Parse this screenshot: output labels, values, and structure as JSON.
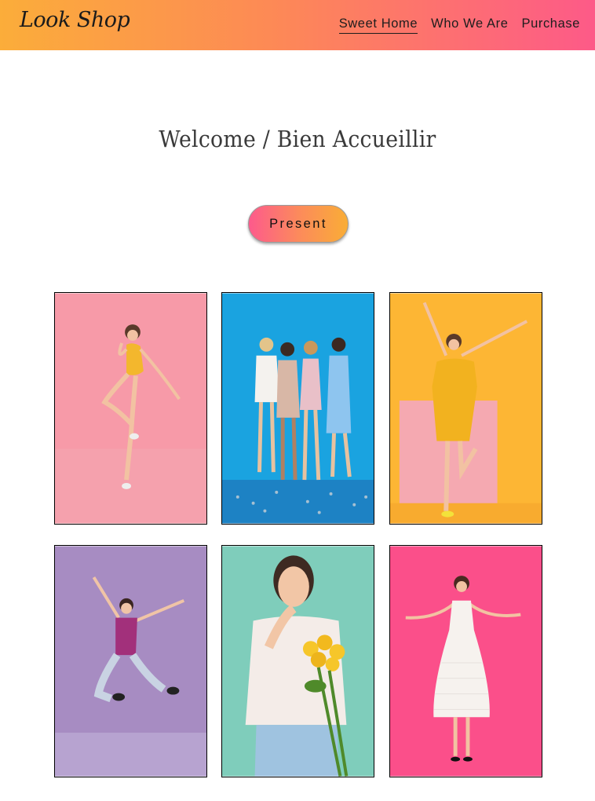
{
  "header": {
    "logo": "Look Shop",
    "nav": [
      {
        "label": "Sweet Home",
        "active": true
      },
      {
        "label": "Who We Are",
        "active": false
      },
      {
        "label": "Purchase",
        "active": false
      }
    ],
    "gradient": [
      "#fbad3a",
      "#fd5a88"
    ]
  },
  "main": {
    "title": "Welcome / Bien Accueillir",
    "button_label": "Present"
  },
  "gallery": {
    "photos": [
      {
        "subject": "woman jumping in yellow dress",
        "background": "#f79aa8"
      },
      {
        "subject": "four women with champagne and confetti",
        "background": "#1aa3e0"
      },
      {
        "subject": "woman with raised arms in yellow dress",
        "background": "#fdb634"
      },
      {
        "subject": "woman jumping in purple top",
        "background": "#a78cc2"
      },
      {
        "subject": "woman holding yellow flowers",
        "background": "#7fcdbb"
      },
      {
        "subject": "woman in white dress shrugging",
        "background": "#fb4f8a"
      }
    ]
  }
}
